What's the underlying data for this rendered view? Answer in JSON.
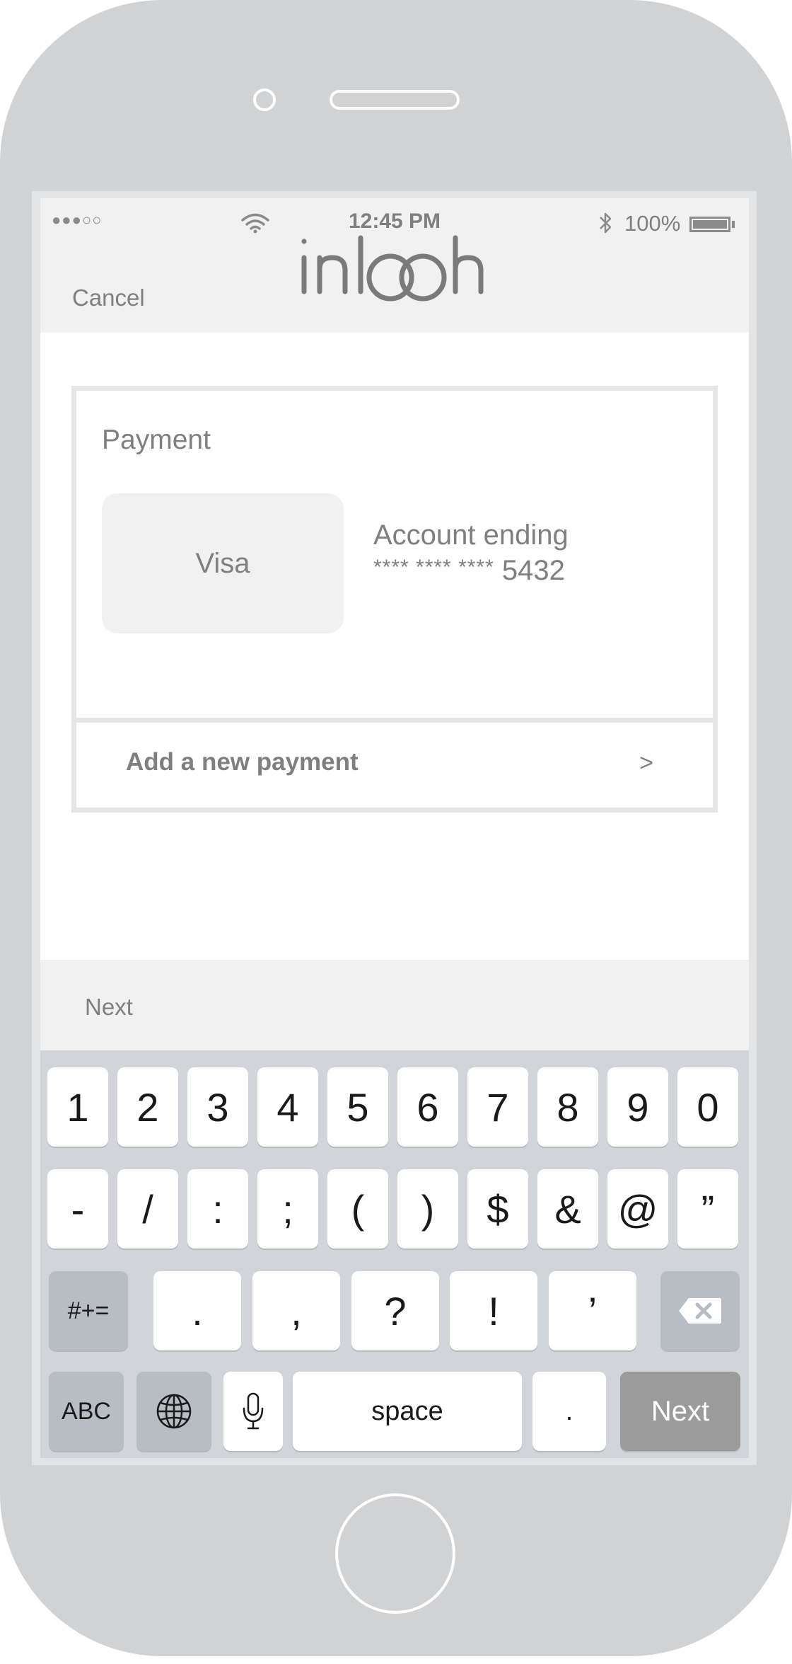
{
  "status_bar": {
    "time": "12:45 PM",
    "battery": "100%",
    "signal": "●●●○○"
  },
  "nav": {
    "cancel_label": "Cancel",
    "logo_text": "inlooh"
  },
  "payment": {
    "title": "Payment",
    "card_brand": "Visa",
    "account_label": "Account ending",
    "masked_prefix": "**** **** ****",
    "last_four": "5432",
    "add_label": "Add a new payment",
    "add_chevron": ">"
  },
  "accessory": {
    "next_label": "Next"
  },
  "keyboard": {
    "row1": [
      "1",
      "2",
      "3",
      "4",
      "5",
      "6",
      "7",
      "8",
      "9",
      "0"
    ],
    "row2": [
      "-",
      "/",
      ":",
      ";",
      "(",
      ")",
      "$",
      "&",
      "@",
      "”"
    ],
    "row3": {
      "symbols_label": "#+=",
      "keys": [
        ".",
        ",",
        "?",
        "!",
        "’"
      ]
    },
    "row4": {
      "abc_label": "ABC",
      "space_label": "space",
      "period_label": ".",
      "next_label": "Next"
    }
  }
}
